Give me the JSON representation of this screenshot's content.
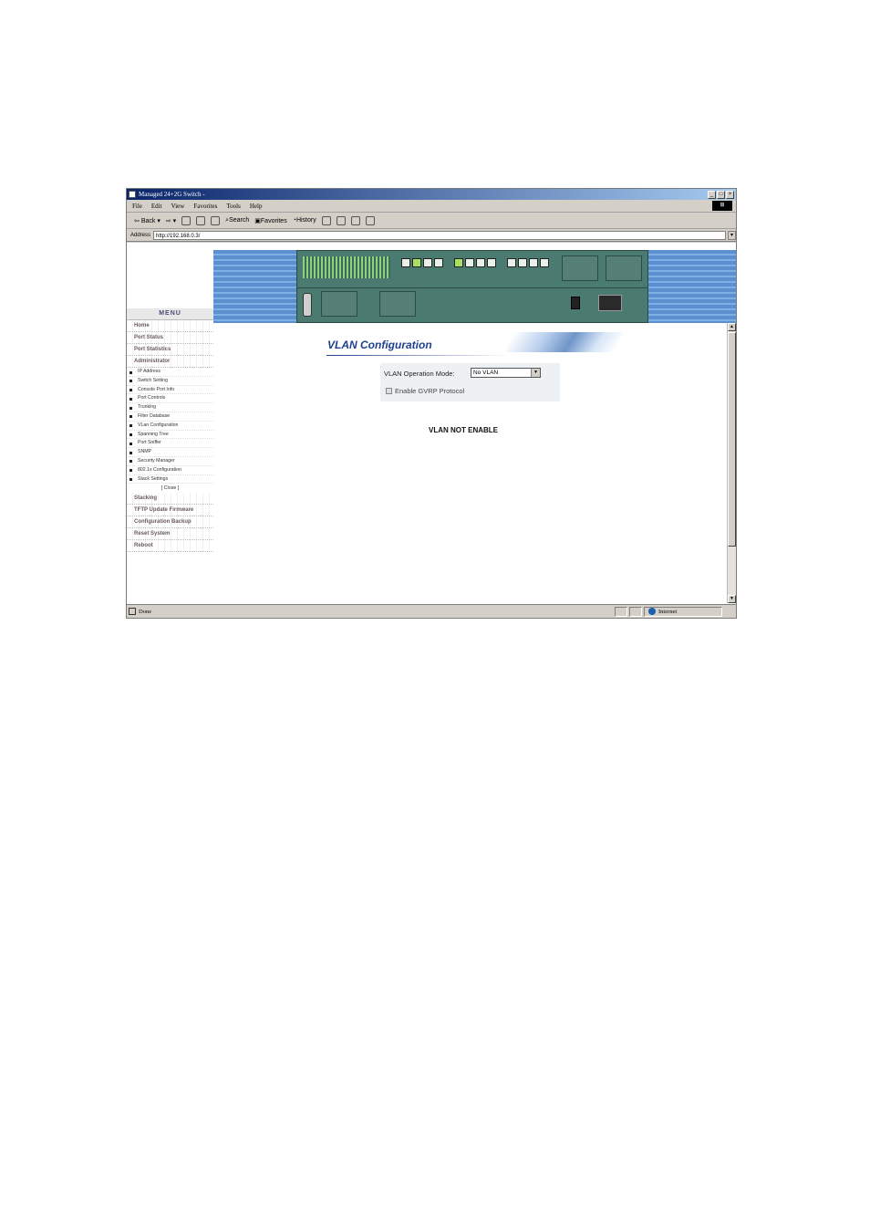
{
  "window": {
    "title": "Managed 24+2G Switch -"
  },
  "menubar": {
    "items": [
      "File",
      "Edit",
      "View",
      "Favorites",
      "Tools",
      "Help"
    ]
  },
  "toolbar": {
    "back": "Back",
    "search": "Search",
    "favorites": "Favorites",
    "history": "History"
  },
  "address": {
    "label": "Address",
    "url": "http://192.168.0.3/"
  },
  "sidebar": {
    "heading": "MENU",
    "top_items": [
      "Home",
      "Port Status",
      "Port Statistics",
      "Administrator"
    ],
    "sub_items": [
      "IP Address",
      "Switch Setting",
      "Console Port Info",
      "Port Controls",
      "Trunking",
      "Filter Database",
      "VLan Configuration",
      "Spanning Tree",
      "Port Sniffer",
      "SNMP",
      "Security Manager",
      "802.1x Configuration",
      "Stack Settings"
    ],
    "close": "[ Close ]",
    "bottom_items": [
      "Stacking",
      "TFTP Update Firmware",
      "Configuration Backup",
      "Reset System",
      "Reboot"
    ]
  },
  "main": {
    "title": "VLAN Configuration",
    "mode_label": "VLAN Operation Mode:",
    "mode_value": "No VLAN",
    "gvrp_label": "Enable GVRP Protocol",
    "gvrp_checked": false,
    "message": "VLAN NOT ENABLE"
  },
  "statusbar": {
    "status": "Done",
    "zone": "Internet"
  },
  "colors": {
    "title_blue": "#1f3f8f",
    "banner_blue": "#5b8fcf",
    "device_green": "#4b7a70"
  }
}
